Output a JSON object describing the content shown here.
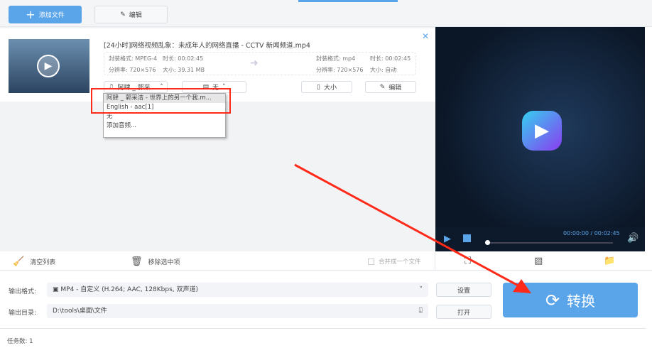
{
  "toolbar": {
    "add_file": "添加文件",
    "edit": "编辑"
  },
  "file": {
    "title": "[24小时]网络视频乱象：未成年人的网络直播 - CCTV 新闻频道.mp4",
    "src": {
      "format": "封装格式: MPEG-4",
      "duration": "时长: 00:02:45",
      "resolution": "分辨率: 720×576",
      "size": "大小: 39.31 MB"
    },
    "dst": {
      "format": "封装格式: mp4",
      "duration": "时长: 00:02:45",
      "resolution": "分辨率: 720×576",
      "size": "大小: 自动"
    },
    "audio_select": "阿肆 _ 郭采...",
    "subtitle_select": "无",
    "size_button": "大小",
    "edit_button": "编辑"
  },
  "audio_dropdown": [
    "阿肆 _ 郭采洁 - 世界上的另一个我.m...",
    "English - aac[1]",
    "无",
    "添加音频..."
  ],
  "player": {
    "time": "00:00:00 / 00:02:45",
    "progress": 0
  },
  "actions": {
    "clear": "清空列表",
    "remove": "移除选中项",
    "merge": "合并成一个文件"
  },
  "output": {
    "format_label": "输出格式:",
    "format_value": "MP4 - 自定义 (H.264; AAC, 128Kbps, 双声道)",
    "settings": "设置",
    "dir_label": "输出目录:",
    "dir_value": "D:\\tools\\桌面\\文件",
    "open": "打开",
    "convert": "转换"
  },
  "status": {
    "tasks": "任务数: 1"
  },
  "colors": {
    "accent": "#5aa4ea",
    "annotation": "#ff2a1a"
  }
}
